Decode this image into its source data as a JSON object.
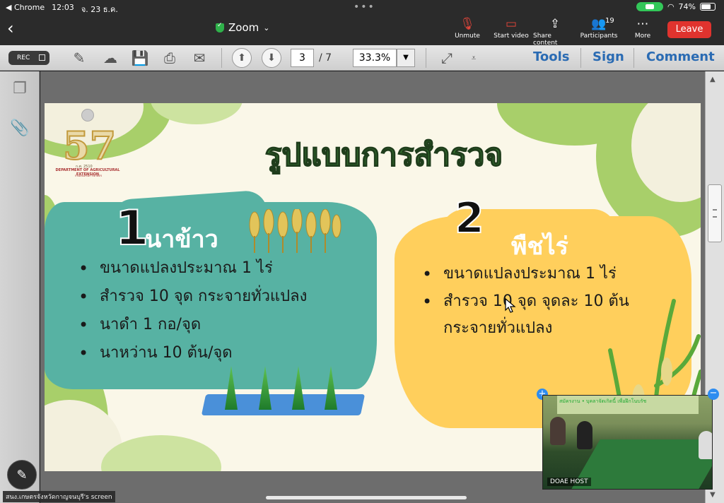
{
  "status_bar": {
    "back_app": "◀ Chrome",
    "time": "12:03",
    "date": "จ. 23 ธ.ค.",
    "battery": "74%",
    "battery_level": 0.74
  },
  "zoom": {
    "title": "Zoom",
    "controls": [
      {
        "label": "Unmute",
        "icon": "mic-muted-icon"
      },
      {
        "label": "Start video",
        "icon": "video-off-icon"
      },
      {
        "label": "Share content",
        "icon": "share-icon"
      },
      {
        "label": "Participants",
        "icon": "participants-icon",
        "count": "19"
      },
      {
        "label": "More",
        "icon": "more-icon"
      }
    ],
    "leave_label": "Leave"
  },
  "pdf_toolbar": {
    "rec_label": "REC",
    "current_page": "3",
    "total_pages": "/ 7",
    "zoom_level": "33.3%",
    "tools_label": "Tools",
    "sign_label": "Sign",
    "comment_label": "Comment"
  },
  "slide": {
    "logo_number": "57",
    "logo_year": "ก.ศ. 2510",
    "logo_dept": "DEPARTMENT OF AGRICULTURAL EXTENSION",
    "logo_sub": "กรมส่งเสริมการเกษตร",
    "title": "รูปแบบการสำรวจ",
    "section1": {
      "number": "1",
      "heading": "นาข้าว",
      "bullets": [
        "ขนาดแปลงประมาณ 1 ไร่",
        "สำรวจ 10 จุด กระจายทั่วแปลง",
        "นาดำ 1 กอ/จุด",
        "นาหว่าน 10 ต้น/จุด"
      ]
    },
    "section2": {
      "number": "2",
      "heading": "พืชไร่",
      "bullets": [
        "ขนาดแปลงประมาณ 1 ไร่",
        "สำรวจ 10 จุด จุดละ 10 ต้น กระจายทั่วแปลง"
      ]
    },
    "colors": {
      "teal": "#57b2a3",
      "yellow": "#ffcf5c",
      "title_green": "#3f8f3a",
      "leaf_green": "#a8cf6a"
    }
  },
  "video_tile": {
    "banner_text": "สมัครงาน • บุคลาจัดเกิดนี้ เพื่อฝึกโนบรัช",
    "participant_label": "DOAE HOST"
  },
  "screen_share_label": "สนง.เกษตรจังหวัดกาญจนบุรี's screen"
}
